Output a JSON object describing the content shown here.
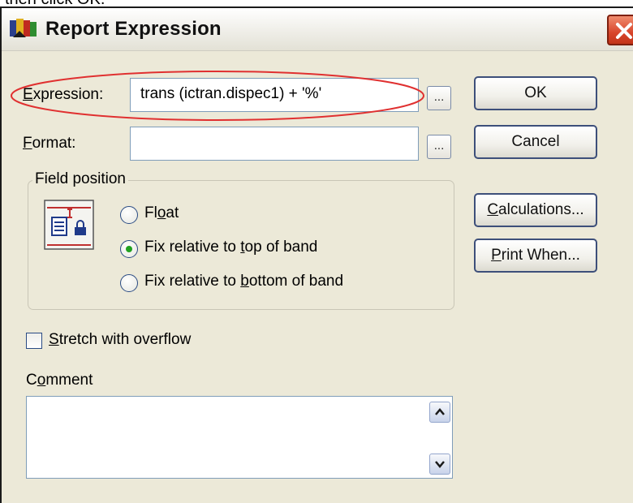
{
  "caption": "then click OK.",
  "dialog": {
    "title": "Report Expression",
    "close_symbol": "✕"
  },
  "expression": {
    "label": "Expression:",
    "label_accel": "E",
    "label_rest": "xpression:",
    "value": "trans (ictran.dispec1) + '%'",
    "browse_label": "..."
  },
  "format": {
    "label_accel": "F",
    "label_rest": "ormat:",
    "value": "",
    "browse_label": "..."
  },
  "buttons": {
    "ok": "OK",
    "cancel": "Cancel",
    "calculations_accel": "C",
    "calculations_rest": "alculations...",
    "print_when_accel": "P",
    "print_when_rest": "rint When..."
  },
  "field_position": {
    "title": "Field position",
    "options": [
      {
        "pre": "Fl",
        "accel": "o",
        "post": "at",
        "selected": false
      },
      {
        "pre": "Fix relative to ",
        "accel": "t",
        "post": "op of band",
        "selected": true
      },
      {
        "pre": "Fix relative to ",
        "accel": "b",
        "post": "ottom of band",
        "selected": false
      }
    ]
  },
  "stretch": {
    "accel": "S",
    "rest": "tretch with overflow",
    "checked": false
  },
  "comment": {
    "label_pre": "C",
    "label_accel": "o",
    "label_post": "mment",
    "value": ""
  },
  "colors": {
    "highlight": "#e03030",
    "radio_dot": "#21a121",
    "close_red": "#d8452b"
  }
}
